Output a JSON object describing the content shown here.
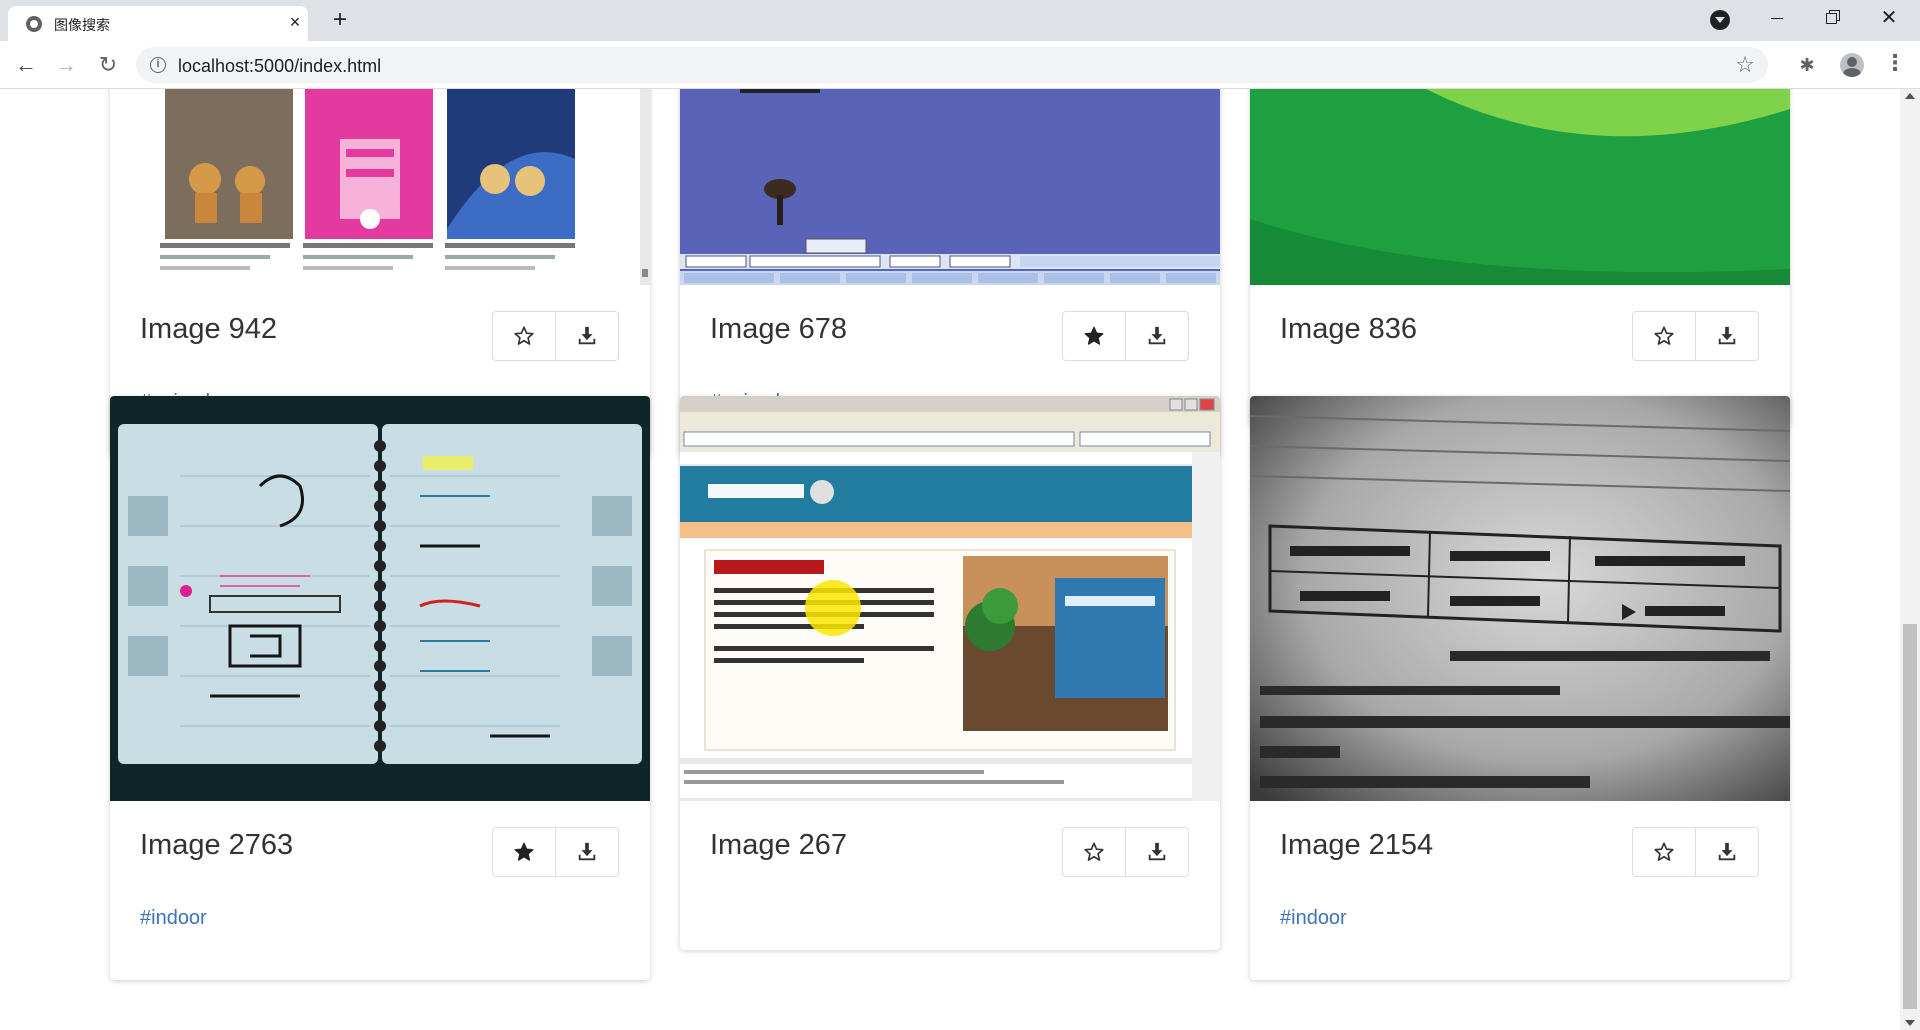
{
  "browser": {
    "tab_title": "图像搜索",
    "url": "localhost:5000/index.html"
  },
  "cards": [
    {
      "title": "Image 942",
      "tag": "#animals",
      "starred": false,
      "thumbnail": "web page screenshot of cat toys"
    },
    {
      "title": "Image 678",
      "tag": "#animals",
      "starred": true,
      "thumbnail": "virtual world game toolbar screenshot"
    },
    {
      "title": "Image 836",
      "tag": "",
      "starred": false,
      "thumbnail": "green abstract shape"
    },
    {
      "title": "Image 2763",
      "tag": "#indoor",
      "starred": true,
      "thumbnail": "handwritten planner notebook April 2008"
    },
    {
      "title": "Image 267",
      "tag": "",
      "starred": false,
      "thumbnail": "Firefox Resident Login page screenshot"
    },
    {
      "title": "Image 2154",
      "tag": "#indoor",
      "starred": false,
      "thumbnail": "newspaper subscription price form"
    }
  ],
  "colors": {
    "tag": "#3d73b8",
    "title": "#333333",
    "chrome_tabbar": "#dee1e6"
  }
}
